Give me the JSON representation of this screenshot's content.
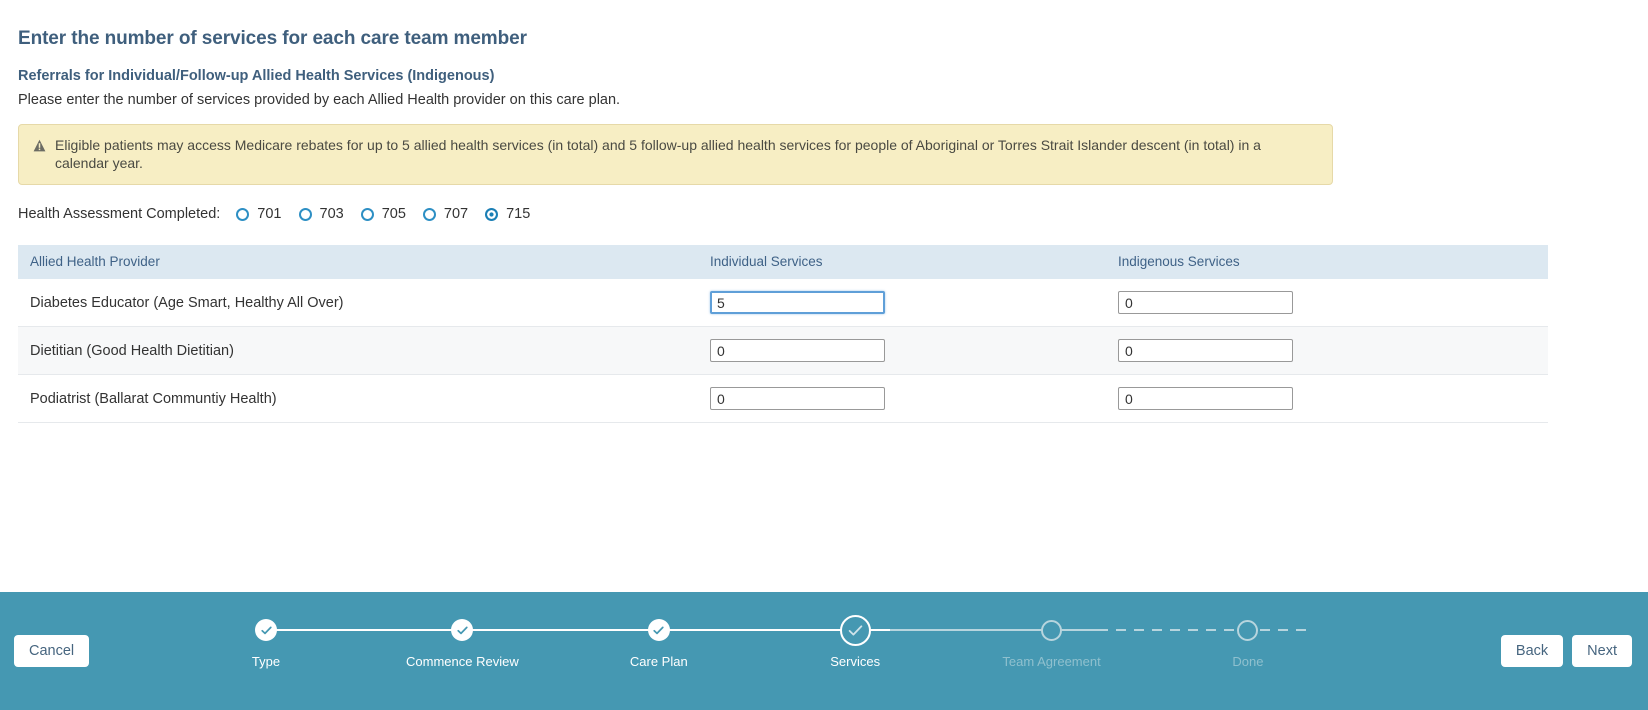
{
  "page": {
    "title": "Enter the number of services for each care team member",
    "section_title": "Referrals for Individual/Follow-up Allied Health Services (Indigenous)",
    "section_desc": "Please enter the number of services provided by each Allied Health provider on this care plan."
  },
  "alert": {
    "icon": "warning-triangle-icon",
    "text": "Eligible patients may access Medicare rebates for up to 5 allied health services (in total) and 5 follow-up allied health services for people of Aboriginal or Torres Strait Islander descent (in total) in a calendar year.",
    "background_color": "#f7eec4",
    "border_color": "#e6d9a8"
  },
  "health_assessment": {
    "label": "Health Assessment Completed:",
    "selected": "715",
    "options": [
      {
        "value": "701"
      },
      {
        "value": "703"
      },
      {
        "value": "705"
      },
      {
        "value": "707"
      },
      {
        "value": "715"
      }
    ]
  },
  "table": {
    "headers": {
      "provider": "Allied Health Provider",
      "individual": "Individual Services",
      "indigenous": "Indigenous Services"
    },
    "rows": [
      {
        "provider": "Diabetes Educator (Age Smart, Healthy All Over)",
        "individual": "5",
        "indigenous": "0",
        "individual_focused": true
      },
      {
        "provider": "Dietitian (Good Health Dietitian)",
        "individual": "0",
        "indigenous": "0",
        "individual_focused": false
      },
      {
        "provider": "Podiatrist (Ballarat Communtiy Health)",
        "individual": "0",
        "indigenous": "0",
        "individual_focused": false
      }
    ]
  },
  "footer": {
    "cancel_label": "Cancel",
    "back_label": "Back",
    "next_label": "Next",
    "background_color": "#4598b2",
    "steps": [
      {
        "label": "Type",
        "state": "done"
      },
      {
        "label": "Commence Review",
        "state": "done"
      },
      {
        "label": "Care Plan",
        "state": "done"
      },
      {
        "label": "Services",
        "state": "current"
      },
      {
        "label": "Team Agreement",
        "state": "todo"
      },
      {
        "label": "Done",
        "state": "todo"
      }
    ]
  },
  "colors": {
    "heading": "#3f5f7d",
    "table_header_bg": "#dce8f1",
    "accent": "#4598b2",
    "radio_accent": "#1b7fb5"
  }
}
